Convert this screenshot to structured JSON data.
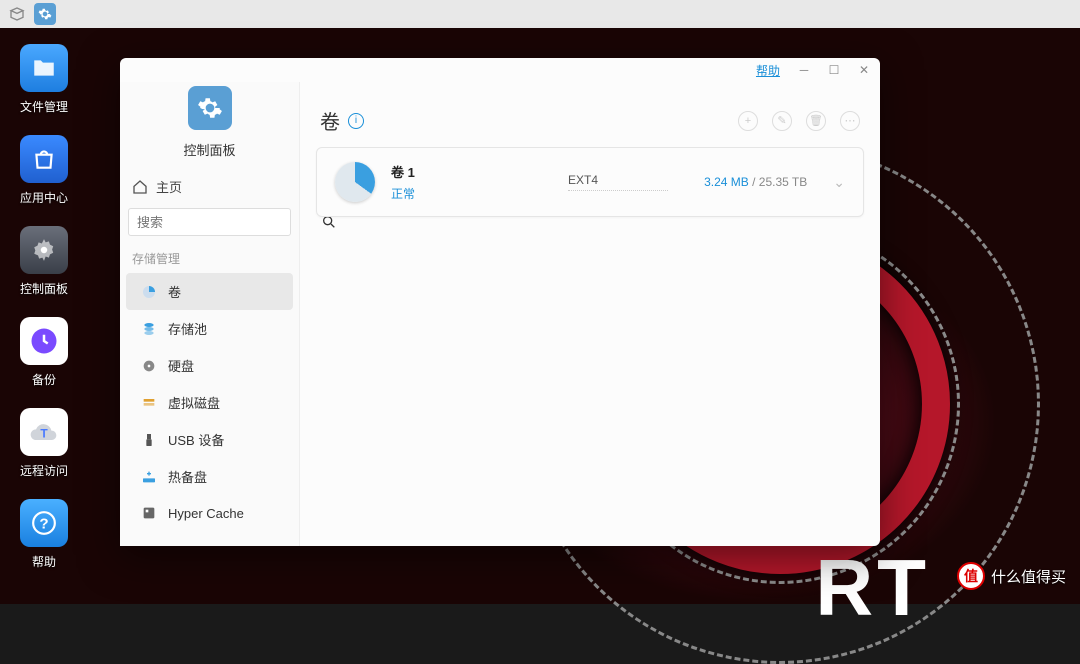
{
  "taskbar": {
    "icons": [
      "packages",
      "settings"
    ]
  },
  "desktop": {
    "items": [
      {
        "name": "file-manager",
        "label": "文件管理"
      },
      {
        "name": "app-center",
        "label": "应用中心"
      },
      {
        "name": "control-panel",
        "label": "控制面板"
      },
      {
        "name": "backup",
        "label": "备份"
      },
      {
        "name": "remote-access",
        "label": "远程访问"
      },
      {
        "name": "help",
        "label": "帮助"
      }
    ]
  },
  "window": {
    "help_label": "帮助",
    "sidebar": {
      "title": "控制面板",
      "home_label": "主页",
      "search_placeholder": "搜索",
      "section_label": "存储管理",
      "items": [
        {
          "name": "volume",
          "label": "卷",
          "active": true
        },
        {
          "name": "storage-pool",
          "label": "存储池"
        },
        {
          "name": "disk",
          "label": "硬盘"
        },
        {
          "name": "virtual-disk",
          "label": "虚拟磁盘"
        },
        {
          "name": "usb-device",
          "label": "USB 设备"
        },
        {
          "name": "hot-spare",
          "label": "热备盘"
        },
        {
          "name": "hyper-cache",
          "label": "Hyper Cache"
        }
      ]
    },
    "main": {
      "title": "卷",
      "volume": {
        "name": "卷 1",
        "status": "正常",
        "filesystem": "EXT4",
        "used": "3.24 MB",
        "total": "25.35 TB",
        "sep": " / "
      }
    }
  },
  "watermark": {
    "badge": "值",
    "text": "什么值得买"
  }
}
